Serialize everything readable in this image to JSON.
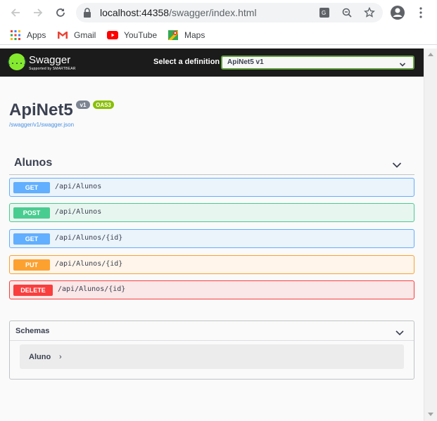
{
  "browser": {
    "url_host": "localhost:44358",
    "url_path": "/swagger/index.html",
    "bookmarks": [
      {
        "label": "Apps",
        "icon": "apps-grid-icon"
      },
      {
        "label": "Gmail",
        "icon": "gmail-icon"
      },
      {
        "label": "YouTube",
        "icon": "youtube-icon"
      },
      {
        "label": "Maps",
        "icon": "maps-icon"
      }
    ]
  },
  "swagger": {
    "logo_text": "{...}",
    "brand": "Swagger",
    "brand_sub": "Supported by SMARTBEAR",
    "definition_label": "Select a definition",
    "definition_value": "ApiNet5 v1"
  },
  "api": {
    "title": "ApiNet5",
    "version": "v1",
    "oas": "OAS3",
    "spec_link": "/swagger/v1/swagger.json"
  },
  "tag": {
    "name": "Alunos",
    "operations": [
      {
        "method": "GET",
        "path": "/api/Alunos"
      },
      {
        "method": "POST",
        "path": "/api/Alunos"
      },
      {
        "method": "GET",
        "path": "/api/Alunos/{id}"
      },
      {
        "method": "PUT",
        "path": "/api/Alunos/{id}"
      },
      {
        "method": "DELETE",
        "path": "/api/Alunos/{id}"
      }
    ]
  },
  "schemas": {
    "title": "Schemas",
    "models": [
      {
        "name": "Aluno",
        "expand_glyph": "›"
      }
    ]
  },
  "colors": {
    "get": "#61affe",
    "post": "#49cc90",
    "put": "#fca130",
    "delete": "#f93e3e",
    "topbar": "#1b1b1b",
    "swagger_green": "#85ea2d"
  }
}
